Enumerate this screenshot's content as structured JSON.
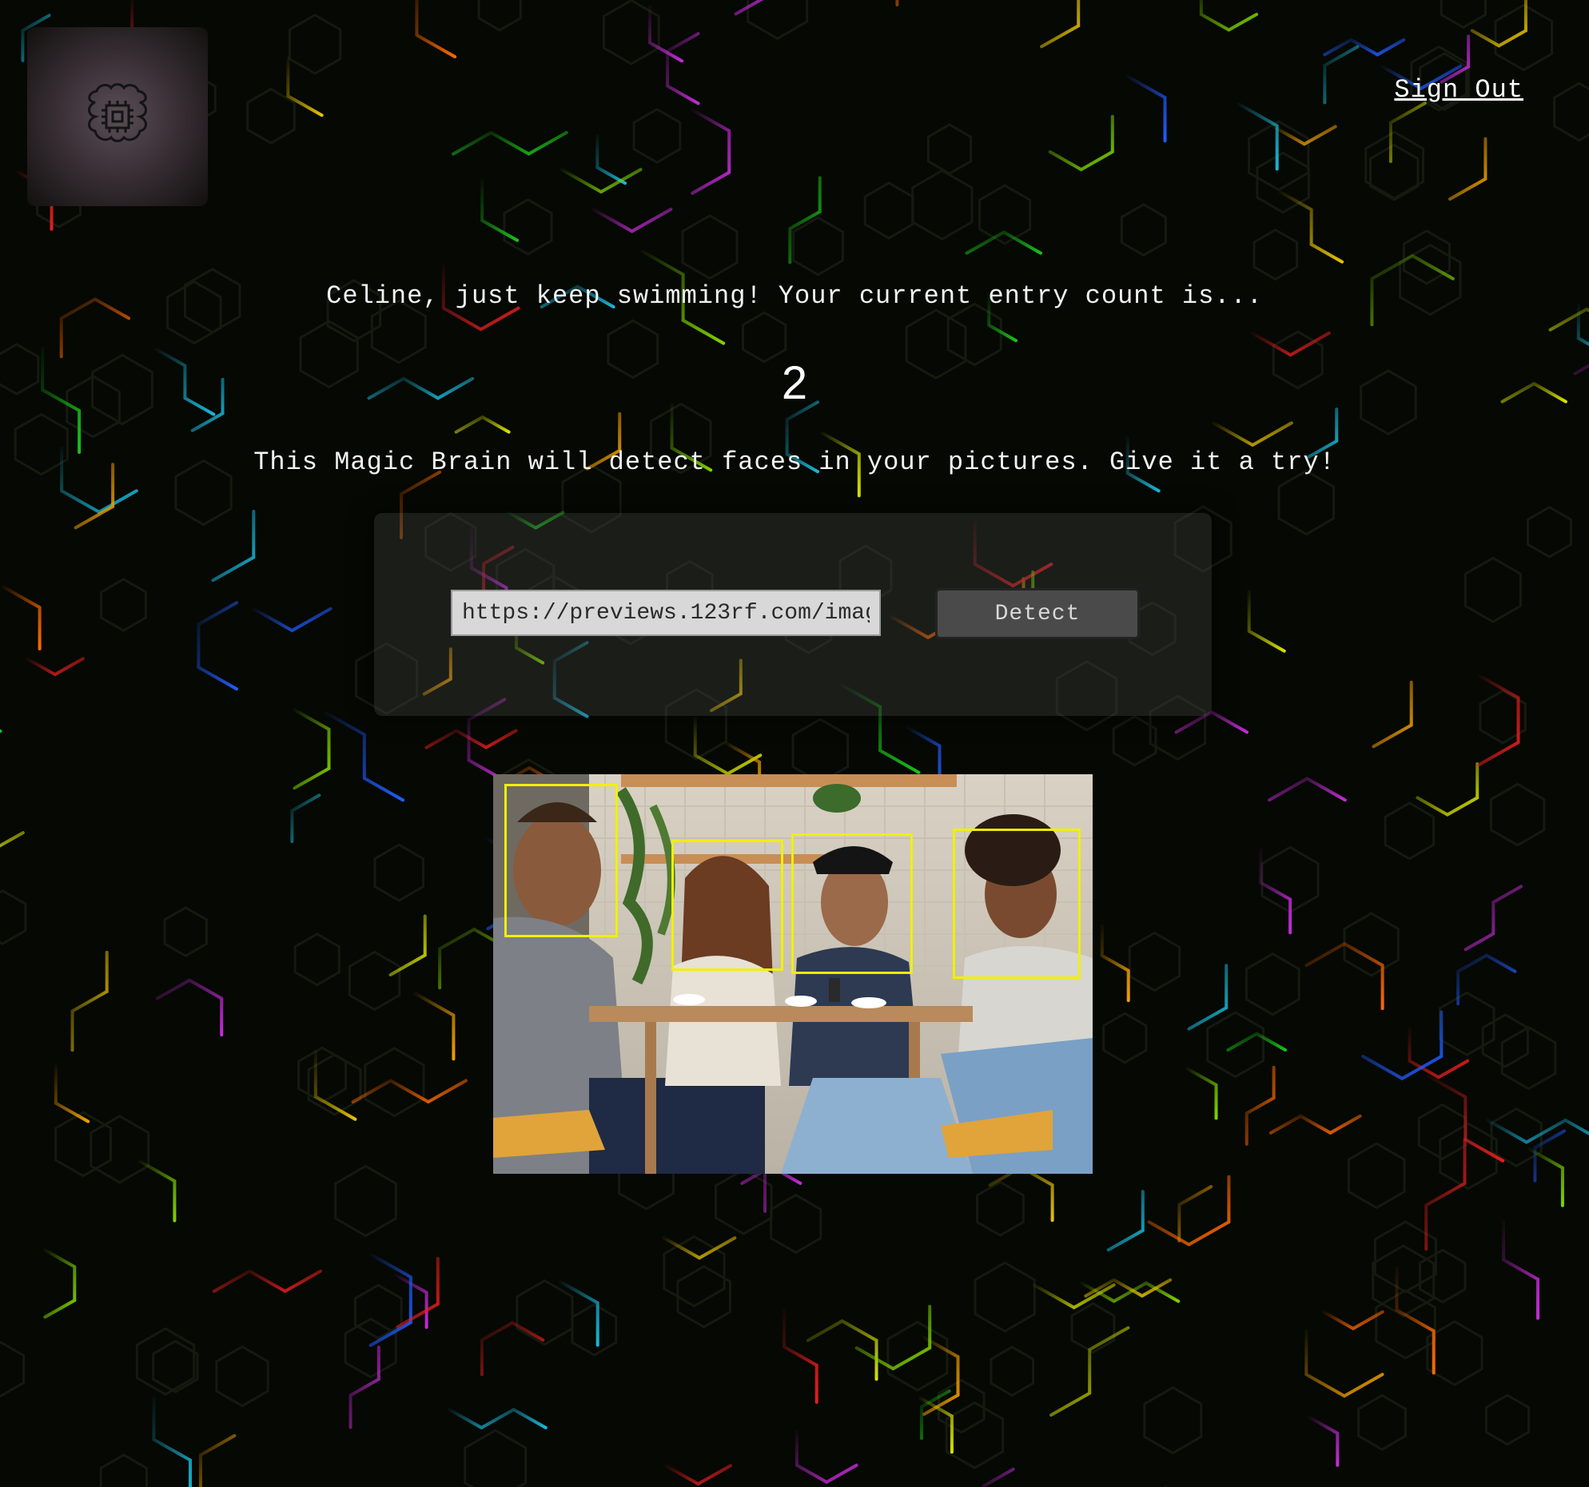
{
  "header": {
    "sign_out_label": "Sign Out"
  },
  "logo": {
    "icon": "brain-chip-icon"
  },
  "main": {
    "greeting": "Celine, just keep swimming! Your current entry count is...",
    "entry_count": "2",
    "tagline": "This Magic Brain will detect faces in your pictures. Give it a try!"
  },
  "form": {
    "url_value": "https://previews.123rf.com/images/...",
    "detect_label": "Detect"
  },
  "result": {
    "image_description_icon": "photo-icon",
    "faces_detected": 4
  },
  "colors": {
    "background": "#060803",
    "face_box": "#f0f000",
    "text": "#f4f4f4"
  }
}
